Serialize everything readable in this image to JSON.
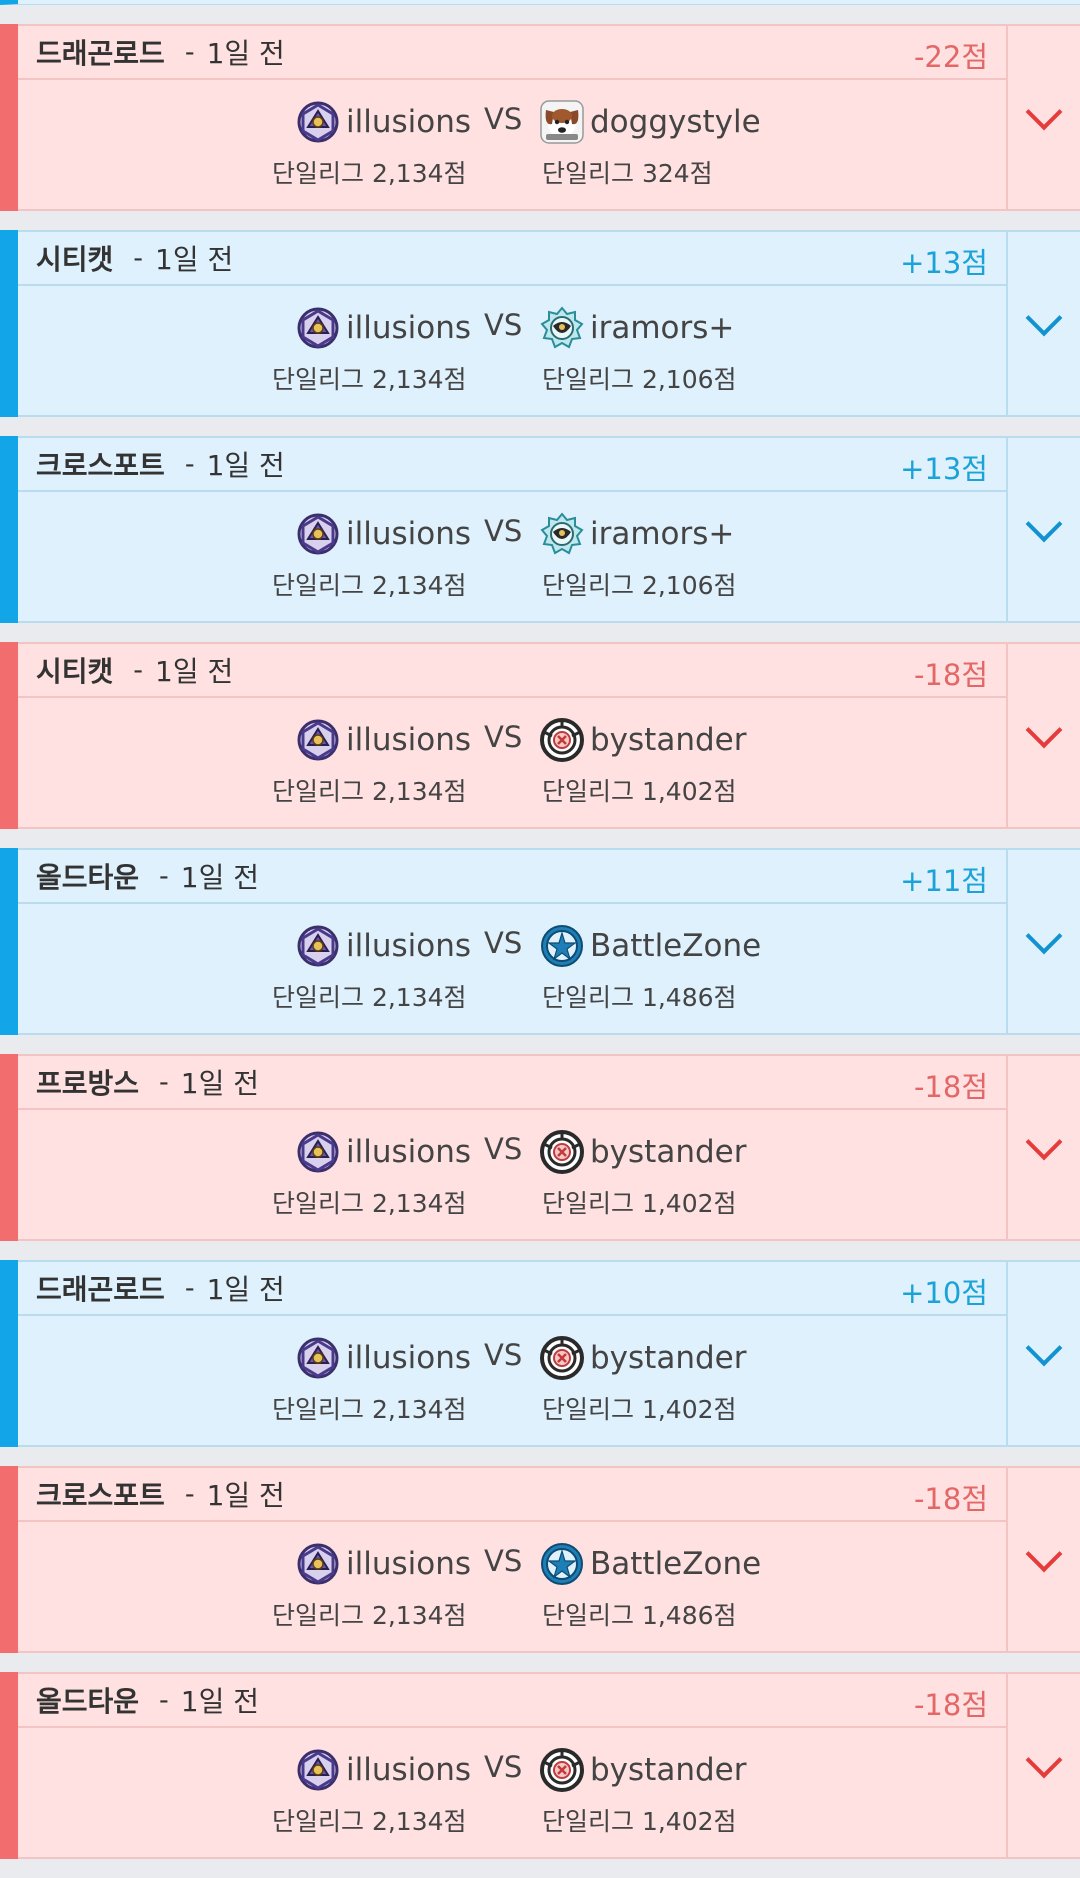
{
  "matches": [
    {
      "result": "loss",
      "map": "드래곤로드",
      "separator": "-",
      "ago": "1일 전",
      "score": "-22점",
      "me": {
        "name": "illusions",
        "icon": "illusions-emblem-icon",
        "league": "단일리그 2,134점"
      },
      "vs": "VS",
      "opponent": {
        "name": "doggystyle",
        "icon": "dog-avatar-icon",
        "league": "단일리그 324점"
      }
    },
    {
      "result": "win",
      "map": "시티캣",
      "separator": "-",
      "ago": "1일 전",
      "score": "+13점",
      "me": {
        "name": "illusions",
        "icon": "illusions-emblem-icon",
        "league": "단일리그 2,134점"
      },
      "vs": "VS",
      "opponent": {
        "name": "iramors+",
        "icon": "iramors-emblem-icon",
        "league": "단일리그 2,106점"
      }
    },
    {
      "result": "win",
      "map": "크로스포트",
      "separator": "-",
      "ago": "1일 전",
      "score": "+13점",
      "me": {
        "name": "illusions",
        "icon": "illusions-emblem-icon",
        "league": "단일리그 2,134점"
      },
      "vs": "VS",
      "opponent": {
        "name": "iramors+",
        "icon": "iramors-emblem-icon",
        "league": "단일리그 2,106점"
      }
    },
    {
      "result": "loss",
      "map": "시티캣",
      "separator": "-",
      "ago": "1일 전",
      "score": "-18점",
      "me": {
        "name": "illusions",
        "icon": "illusions-emblem-icon",
        "league": "단일리그 2,134점"
      },
      "vs": "VS",
      "opponent": {
        "name": "bystander",
        "icon": "bystander-emblem-icon",
        "league": "단일리그 1,402점"
      }
    },
    {
      "result": "win",
      "map": "올드타운",
      "separator": "-",
      "ago": "1일 전",
      "score": "+11점",
      "me": {
        "name": "illusions",
        "icon": "illusions-emblem-icon",
        "league": "단일리그 2,134점"
      },
      "vs": "VS",
      "opponent": {
        "name": "BattleZone",
        "icon": "battlezone-star-icon",
        "league": "단일리그 1,486점"
      }
    },
    {
      "result": "loss",
      "map": "프로방스",
      "separator": "-",
      "ago": "1일 전",
      "score": "-18점",
      "me": {
        "name": "illusions",
        "icon": "illusions-emblem-icon",
        "league": "단일리그 2,134점"
      },
      "vs": "VS",
      "opponent": {
        "name": "bystander",
        "icon": "bystander-emblem-icon",
        "league": "단일리그 1,402점"
      }
    },
    {
      "result": "win",
      "map": "드래곤로드",
      "separator": "-",
      "ago": "1일 전",
      "score": "+10점",
      "me": {
        "name": "illusions",
        "icon": "illusions-emblem-icon",
        "league": "단일리그 2,134점"
      },
      "vs": "VS",
      "opponent": {
        "name": "bystander",
        "icon": "bystander-emblem-icon",
        "league": "단일리그 1,402점"
      }
    },
    {
      "result": "loss",
      "map": "크로스포트",
      "separator": "-",
      "ago": "1일 전",
      "score": "-18점",
      "me": {
        "name": "illusions",
        "icon": "illusions-emblem-icon",
        "league": "단일리그 2,134점"
      },
      "vs": "VS",
      "opponent": {
        "name": "BattleZone",
        "icon": "battlezone-star-icon",
        "league": "단일리그 1,486점"
      }
    },
    {
      "result": "loss",
      "map": "올드타운",
      "separator": "-",
      "ago": "1일 전",
      "score": "-18점",
      "me": {
        "name": "illusions",
        "icon": "illusions-emblem-icon",
        "league": "단일리그 2,134점"
      },
      "vs": "VS",
      "opponent": {
        "name": "bystander",
        "icon": "bystander-emblem-icon",
        "league": "단일리그 1,402점"
      }
    }
  ],
  "colors": {
    "loss_accent": "#f26d6d",
    "win_accent": "#12a6e8",
    "loss_bg": "#ffe1e1",
    "win_bg": "#dff1fd"
  }
}
